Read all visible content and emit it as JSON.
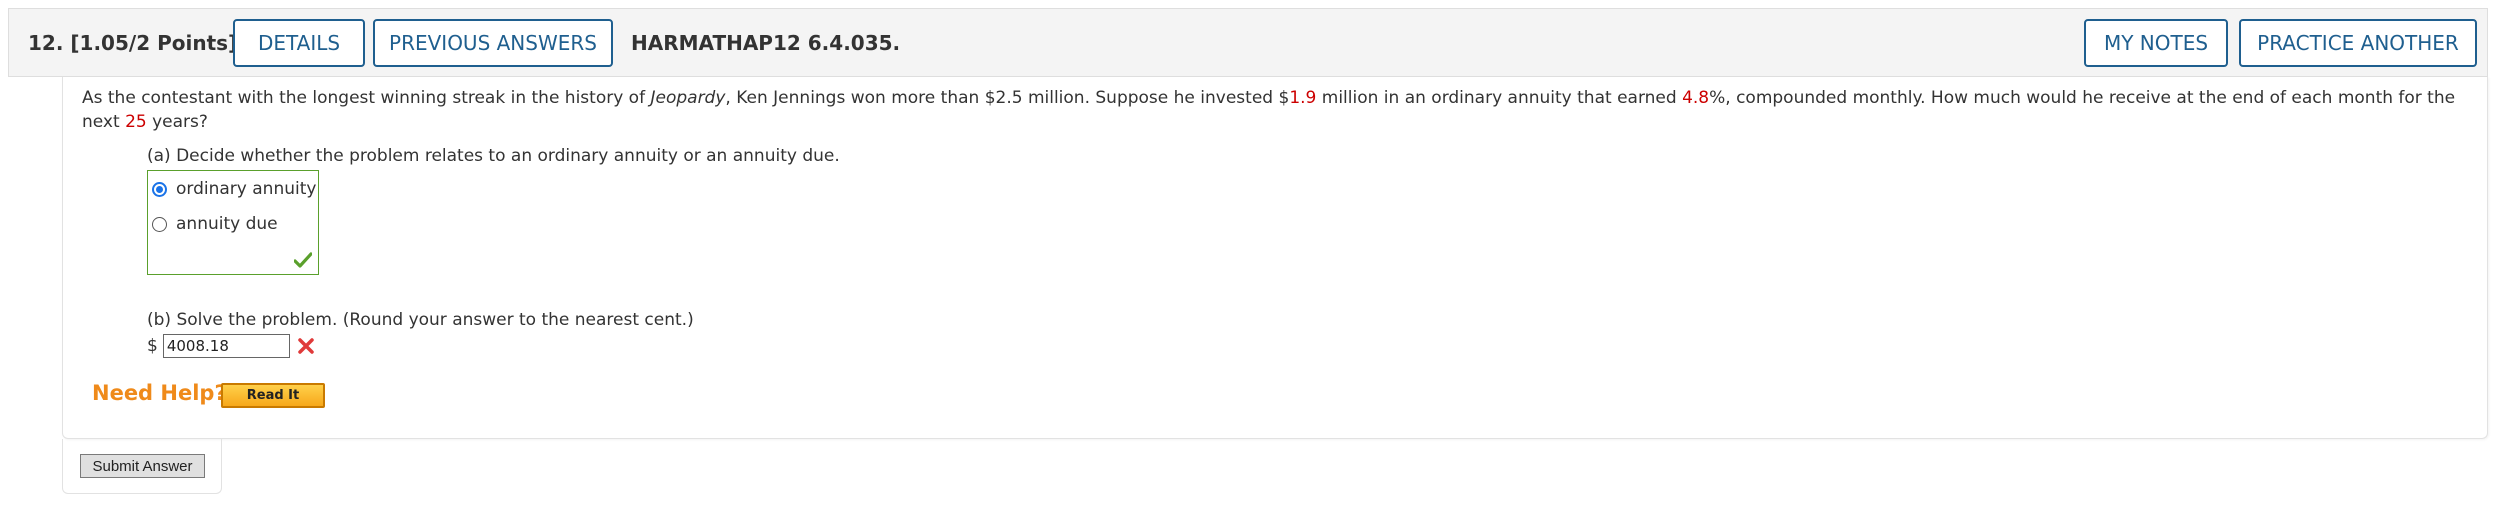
{
  "header": {
    "question_number": "12.",
    "points": "[1.05/2 Points]",
    "details_label": "DETAILS",
    "previous_answers_label": "PREVIOUS ANSWERS",
    "question_code": "HARMATHAP12 6.4.035.",
    "my_notes_label": "MY NOTES",
    "practice_another_label": "PRACTICE ANOTHER"
  },
  "question": {
    "text_1": "As the contestant with the longest winning streak in the history of ",
    "text_italic": "Jeopardy",
    "text_2": ", Ken Jennings won more than $2.5 million. Suppose he invested $",
    "amount": "1.9",
    "text_3": " million in an ordinary annuity that earned ",
    "rate": "4.8",
    "text_4": "%, compounded monthly. How much would he receive at the end of each month for the next ",
    "years": "25",
    "text_5": " years?"
  },
  "part_a": {
    "prompt": "(a) Decide whether the problem relates to an ordinary annuity or an annuity due.",
    "options": [
      {
        "label": "ordinary annuity",
        "selected": true
      },
      {
        "label": "annuity due",
        "selected": false
      }
    ],
    "status": "correct"
  },
  "part_b": {
    "prompt": "(b) Solve the problem. (Round your answer to the nearest cent.)",
    "currency": "$",
    "answer_value": "4008.18",
    "status": "incorrect"
  },
  "help": {
    "need_help_label": "Need Help?",
    "read_it_label": "Read It"
  },
  "submit_label": "Submit Answer",
  "colors": {
    "accent": "#1f5f8f",
    "correct": "#5aa02c",
    "incorrect": "#e03a3a",
    "need_help": "#ef8a1a",
    "highlight_value": "#cc0000"
  }
}
